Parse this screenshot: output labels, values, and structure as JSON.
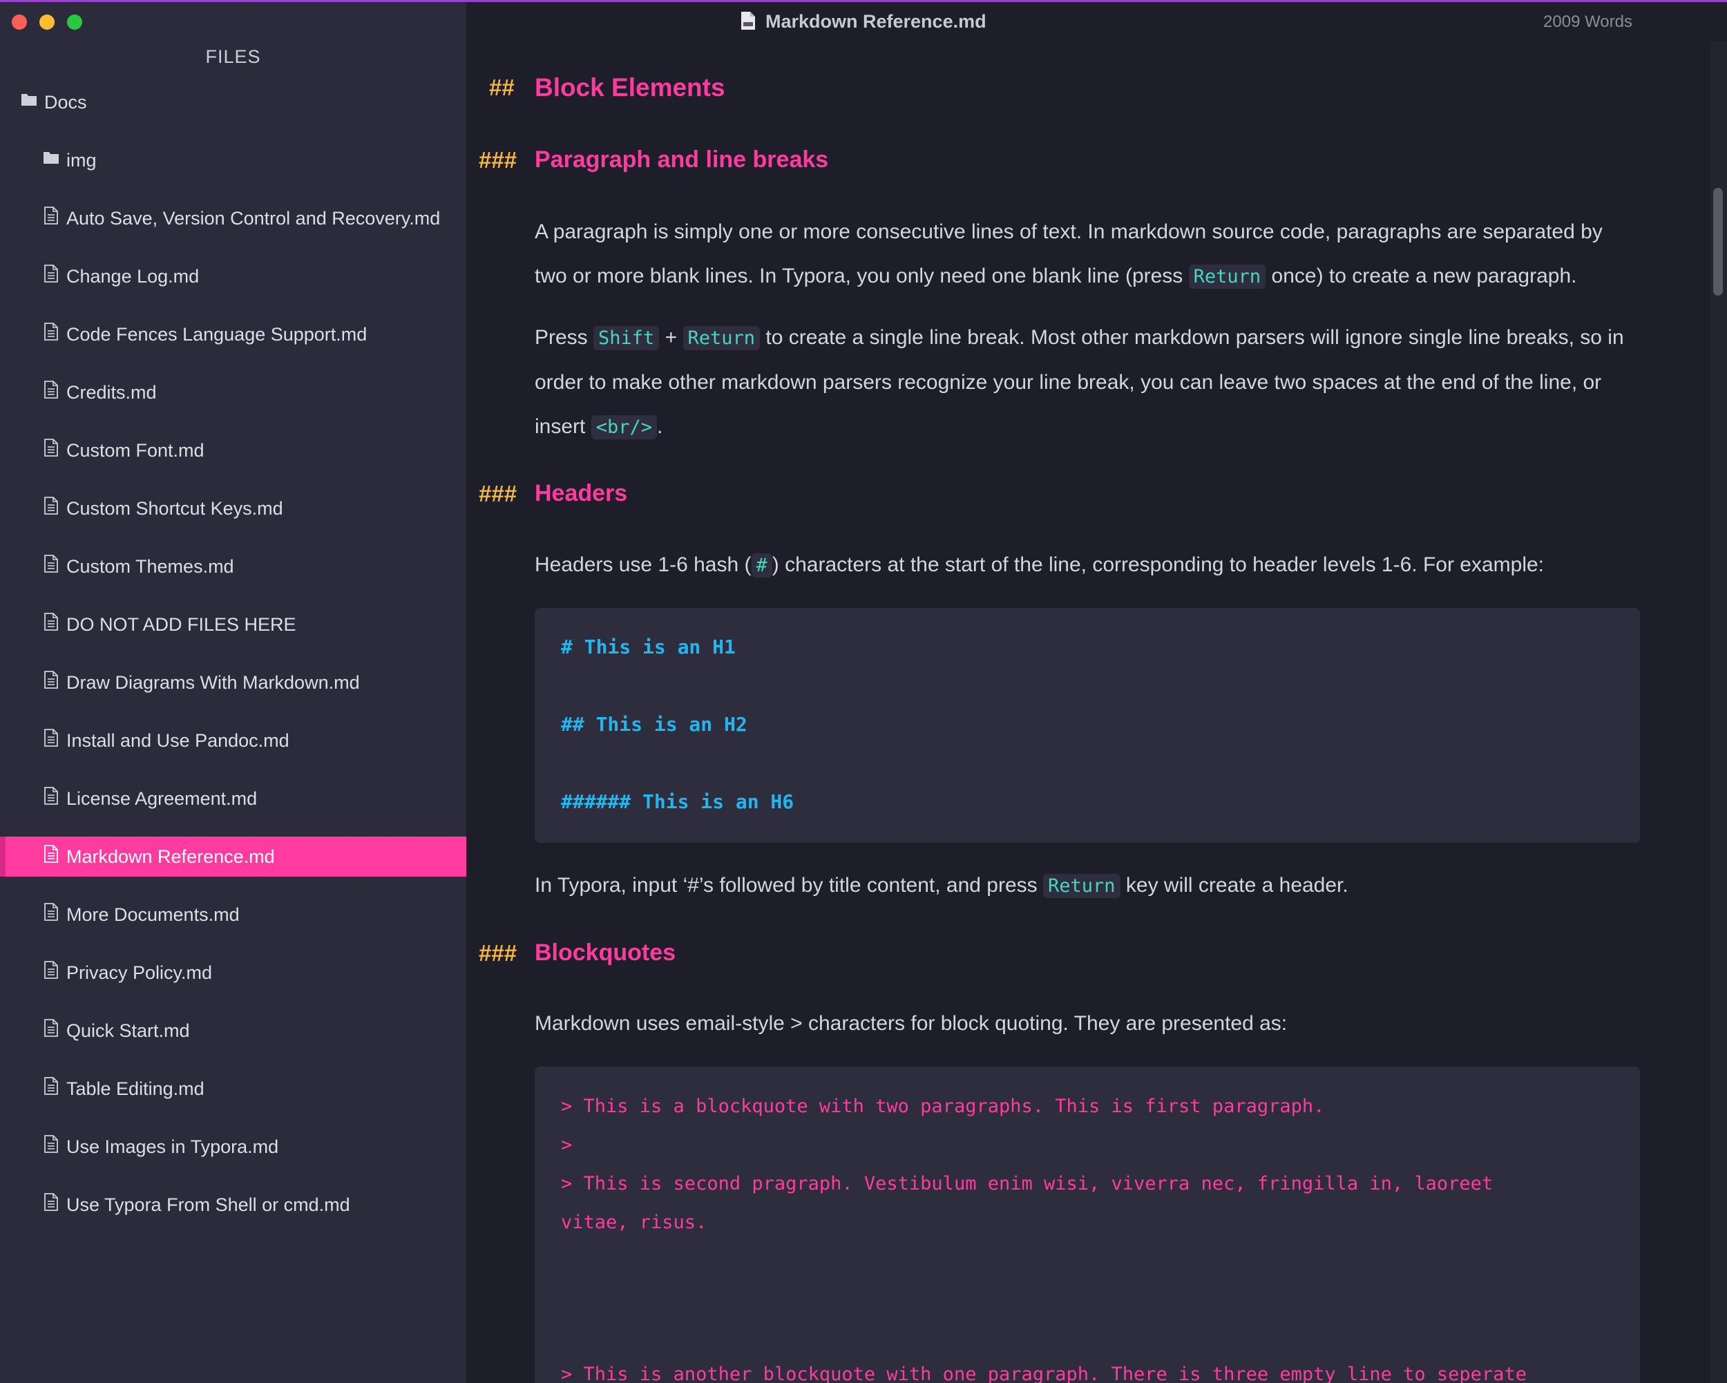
{
  "window": {
    "title": "Markdown Reference.md",
    "word_count": "2009 Words"
  },
  "sidebar": {
    "title": "FILES",
    "items": [
      {
        "label": "Docs",
        "kind": "folder"
      },
      {
        "label": "img",
        "kind": "folder"
      },
      {
        "label": "Auto Save, Version Control and Recovery.md",
        "kind": "file"
      },
      {
        "label": "Change Log.md",
        "kind": "file"
      },
      {
        "label": "Code Fences Language Support.md",
        "kind": "file"
      },
      {
        "label": "Credits.md",
        "kind": "file"
      },
      {
        "label": "Custom Font.md",
        "kind": "file"
      },
      {
        "label": "Custom Shortcut Keys.md",
        "kind": "file"
      },
      {
        "label": "Custom Themes.md",
        "kind": "file"
      },
      {
        "label": "DO NOT ADD FILES HERE",
        "kind": "file"
      },
      {
        "label": "Draw Diagrams With Markdown.md",
        "kind": "file"
      },
      {
        "label": "Install and Use Pandoc.md",
        "kind": "file"
      },
      {
        "label": "License Agreement.md",
        "kind": "file"
      },
      {
        "label": "Markdown Reference.md",
        "kind": "file",
        "active": true
      },
      {
        "label": "More Documents.md",
        "kind": "file"
      },
      {
        "label": "Privacy Policy.md",
        "kind": "file"
      },
      {
        "label": "Quick Start.md",
        "kind": "file"
      },
      {
        "label": "Table Editing.md",
        "kind": "file"
      },
      {
        "label": "Use Images in Typora.md",
        "kind": "file"
      },
      {
        "label": "Use Typora From Shell or cmd.md",
        "kind": "file"
      }
    ]
  },
  "doc": {
    "h2_marker": "##",
    "h3_marker": "###",
    "block_elements": "Block Elements",
    "para_heading": "Paragraph and line breaks",
    "p1": {
      "before": "A paragraph is simply one or more consecutive lines of text. In markdown source code, paragraphs are separated by two or more blank lines. In Typora, you only need one blank line (press ",
      "code": "Return",
      "after": " once) to create a new paragraph."
    },
    "p2": {
      "t1": "Press ",
      "code1": "Shift",
      "t2": " + ",
      "code2": "Return",
      "t3": " to create a single line break. Most other markdown parsers will ignore single line breaks, so in order to make other markdown parsers recognize your line break, you can leave two spaces at the end of the line, or insert ",
      "code3": "<br/>",
      "t4": "."
    },
    "headers_heading": "Headers",
    "p3": {
      "before": "Headers use 1-6 hash (",
      "code": "#",
      "after": ") characters at the start of the line, corresponding to header levels 1-6. For example:"
    },
    "header_code": [
      "# This is an H1",
      "## This is an H2",
      "###### This is an H6"
    ],
    "p4": {
      "before": "In Typora, input ‘#’s followed by title content, and press ",
      "code": "Return",
      "after": " key will create a header."
    },
    "blockquotes_heading": "Blockquotes",
    "p5": "Markdown uses email-style > characters for block quoting. They are presented as:",
    "quote_code": [
      "> This is a blockquote with two paragraphs. This is first paragraph.",
      ">",
      "> This is second pragraph. Vestibulum enim wisi, viverra nec, fringilla in, laoreet",
      "vitae, risus.",
      "> This is another blockquote with one paragraph. There is three empty line to seperate"
    ]
  },
  "colors": {
    "accent": "#ff3ba0",
    "hash_marker": "#f5b83d",
    "inline_code": "#45d6c4",
    "code_heading": "#21b6f0"
  }
}
